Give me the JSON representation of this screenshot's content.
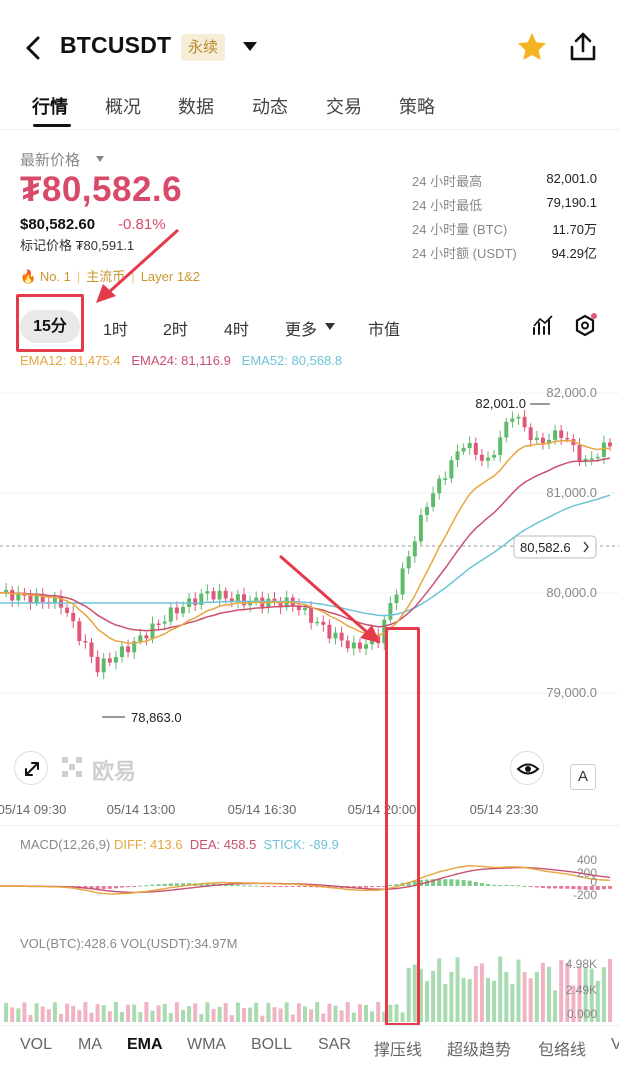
{
  "header": {
    "title": "BTCUSDT",
    "badge": "永续"
  },
  "tabs": [
    "行情",
    "概况",
    "数据",
    "动态",
    "交易",
    "策略"
  ],
  "price": {
    "label": "最新价格",
    "main": "₮80,582.6",
    "usd": "$80,582.60",
    "change": "-0.81%",
    "mark": "标记价格 ₮80,591.1"
  },
  "tags": [
    "No. 1",
    "主流币",
    "Layer 1&2"
  ],
  "stats": [
    {
      "label": "24 小时最高",
      "value": "82,001.0"
    },
    {
      "label": "24 小时最低",
      "value": "79,190.1"
    },
    {
      "label": "24 小时量 (BTC)",
      "value": "11.70万"
    },
    {
      "label": "24 小时额 (USDT)",
      "value": "94.29亿"
    }
  ],
  "timeframes": {
    "active": "15分",
    "items": [
      "1时",
      "2时",
      "4时",
      "更多",
      "市值"
    ]
  },
  "ema": {
    "ema12": "EMA12: 81,475.4",
    "ema24": "EMA24: 81,116.9",
    "ema52": "EMA52: 80,568.8"
  },
  "chart": {
    "high_label": "82,001.0",
    "low_label": "78,863.0",
    "current_label": "80,582.6",
    "y_ticks": [
      "82,000.0",
      "81,000.0",
      "80,000.0",
      "79,000.0"
    ],
    "x_ticks": [
      "05/14 09:30",
      "05/14 13:00",
      "05/14 16:30",
      "05/14 20:00",
      "05/14 23:30"
    ],
    "watermark": "欧易",
    "font_btn": "A"
  },
  "macd": {
    "title": "MACD(12,26,9)",
    "diff": "DIFF: 413.6",
    "dea": "DEA: 458.5",
    "stick": "STICK: -89.9",
    "ticks": [
      "400",
      "200",
      "0",
      "-200"
    ]
  },
  "vol": {
    "title": "VOL(BTC):428.6 VOL(USDT):34.97M",
    "ticks": [
      "4.98K",
      "2.49K",
      "0.000"
    ]
  },
  "indicators": {
    "active": "EMA",
    "items": [
      "VOL",
      "MA",
      "EMA",
      "WMA",
      "BOLL",
      "SAR",
      "撑压线",
      "超级趋势",
      "包络线",
      "V"
    ]
  },
  "colors": {
    "up": "#5dbb6a",
    "down": "#e1577a",
    "ema12": "#e6a640",
    "ema24": "#c9506e",
    "ema52": "#6fc3d8",
    "accent": "#e43a4a"
  }
}
